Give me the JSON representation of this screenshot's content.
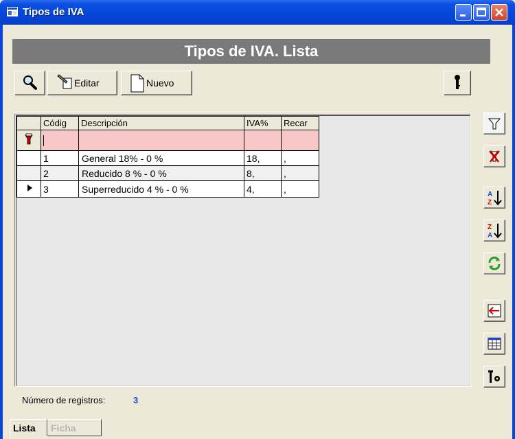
{
  "window": {
    "title": "Tipos de IVA"
  },
  "header": {
    "title": "Tipos de IVA. Lista"
  },
  "toolbar": {
    "edit_label": "Editar",
    "new_label": "Nuevo"
  },
  "grid": {
    "columns": [
      "Códig",
      "Descripción",
      "IVA%",
      "Recar"
    ],
    "rows": [
      {
        "codigo": "1",
        "descripcion": "General 18%  -  0 %",
        "iva": "18,",
        "recargo": ","
      },
      {
        "codigo": "2",
        "descripcion": "Reducido 8 %  -  0 %",
        "iva": "8,",
        "recargo": ","
      },
      {
        "codigo": "3",
        "descripcion": "Superreducido 4 %  -  0 %",
        "iva": "4,",
        "recargo": ","
      }
    ]
  },
  "footer": {
    "count_label": "Número de registros:",
    "count_value": "3"
  },
  "tabs": [
    {
      "label": "Lista",
      "active": true
    },
    {
      "label": "Ficha",
      "active": false
    }
  ],
  "icons": {
    "search": "search-icon",
    "edit": "edit-icon",
    "new": "new-document-icon",
    "key": "key-icon",
    "filter": "filter-icon",
    "clear_filter": "clear-filter-icon",
    "sort_asc": "sort-az-icon",
    "sort_desc": "sort-za-icon",
    "refresh": "refresh-icon",
    "exit": "exit-icon",
    "grid": "grid-icon",
    "config": "config-icon"
  },
  "colors": {
    "title_bar": "#0546d8",
    "header_band": "#7a7a7a",
    "new_row": "#f7c6c6",
    "count_value": "#1a4fd0"
  }
}
